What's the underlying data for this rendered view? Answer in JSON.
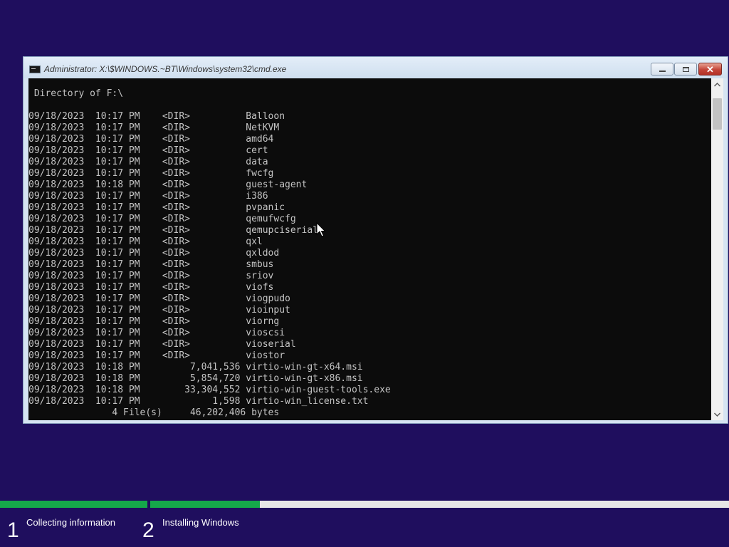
{
  "window": {
    "title": "Administrator: X:\\$WINDOWS.~BT\\Windows\\system32\\cmd.exe",
    "controls": {
      "minimize": "minimize",
      "maximize": "maximize",
      "close": "✕"
    },
    "icons": {
      "app": "cmd-icon",
      "up": "scroll-up-icon",
      "down": "scroll-down-icon"
    }
  },
  "console": {
    "lines": [
      " Directory of F:\\",
      "",
      "09/18/2023  10:17 PM    <DIR>          Balloon",
      "09/18/2023  10:17 PM    <DIR>          NetKVM",
      "09/18/2023  10:17 PM    <DIR>          amd64",
      "09/18/2023  10:17 PM    <DIR>          cert",
      "09/18/2023  10:17 PM    <DIR>          data",
      "09/18/2023  10:17 PM    <DIR>          fwcfg",
      "09/18/2023  10:18 PM    <DIR>          guest-agent",
      "09/18/2023  10:17 PM    <DIR>          i386",
      "09/18/2023  10:17 PM    <DIR>          pvpanic",
      "09/18/2023  10:17 PM    <DIR>          qemufwcfg",
      "09/18/2023  10:17 PM    <DIR>          qemupciserial",
      "09/18/2023  10:17 PM    <DIR>          qxl",
      "09/18/2023  10:17 PM    <DIR>          qxldod",
      "09/18/2023  10:17 PM    <DIR>          smbus",
      "09/18/2023  10:17 PM    <DIR>          sriov",
      "09/18/2023  10:17 PM    <DIR>          viofs",
      "09/18/2023  10:17 PM    <DIR>          viogpudo",
      "09/18/2023  10:17 PM    <DIR>          vioinput",
      "09/18/2023  10:17 PM    <DIR>          viorng",
      "09/18/2023  10:17 PM    <DIR>          vioscsi",
      "09/18/2023  10:17 PM    <DIR>          vioserial",
      "09/18/2023  10:17 PM    <DIR>          viostor",
      "09/18/2023  10:18 PM         7,041,536 virtio-win-gt-x64.msi",
      "09/18/2023  10:18 PM         5,854,720 virtio-win-gt-x86.msi",
      "09/18/2023  10:18 PM        33,304,552 virtio-win-guest-tools.exe",
      "09/18/2023  10:17 PM             1,598 virtio-win_license.txt",
      "               4 File(s)     46,202,406 bytes"
    ]
  },
  "setup": {
    "steps": [
      {
        "number": "1",
        "label": "Collecting information",
        "progress": 1.0
      },
      {
        "number": "2",
        "label": "Installing Windows",
        "progress": 0.19
      }
    ],
    "colors": {
      "background": "#1f0e5e",
      "progress": "#15a84a",
      "track": "#e6e6e6"
    }
  }
}
